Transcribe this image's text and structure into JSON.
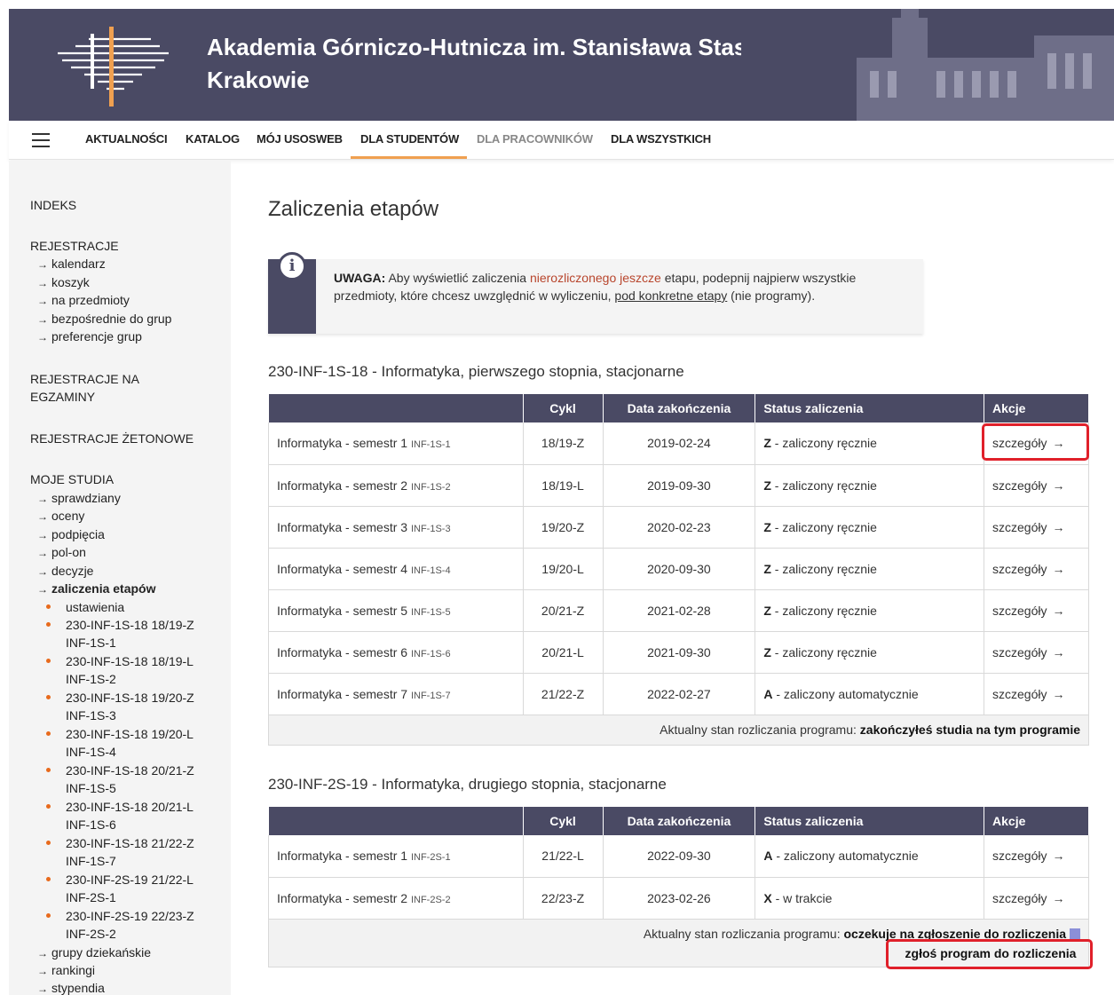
{
  "header": {
    "university_title": "Akademia Górniczo-Hutnicza im. Stanisława Staszica w Krakowie"
  },
  "topnav": {
    "items": [
      "AKTUALNOŚCI",
      "KATALOG",
      "MÓJ USOSWEB",
      "DLA STUDENTÓW",
      "DLA PRACOWNIKÓW",
      "DLA WSZYSTKICH"
    ],
    "active": "DLA STUDENTÓW"
  },
  "sidebar": {
    "indeks": "INDEKS",
    "rejestracje": "REJESTRACJE",
    "rejestracje_links": [
      "kalendarz",
      "koszyk",
      "na przedmioty",
      "bezpośrednie do grup",
      "preferencje grup"
    ],
    "rejestracje_egzaminy": "REJESTRACJE NA EGZAMINY",
    "rejestracje_zetonowe": "REJESTRACJE ŻETONOWE",
    "moje_studia": "MOJE STUDIA",
    "moje_studia_links": [
      "sprawdziany",
      "oceny",
      "podpięcia",
      "pol-on",
      "decyzje",
      "zaliczenia etapów"
    ],
    "zaliczenia_sub": [
      "ustawienia",
      "230-INF-1S-18 18/19-Z INF-1S-1",
      "230-INF-1S-18 18/19-L INF-1S-2",
      "230-INF-1S-18 19/20-Z INF-1S-3",
      "230-INF-1S-18 19/20-L INF-1S-4",
      "230-INF-1S-18 20/21-Z INF-1S-5",
      "230-INF-1S-18 20/21-L INF-1S-6",
      "230-INF-1S-18 21/22-Z INF-1S-7",
      "230-INF-2S-19 21/22-L INF-2S-1",
      "230-INF-2S-19 22/23-Z INF-2S-2"
    ],
    "bottom_links": [
      "grupy dziekańskie",
      "rankingi",
      "stypendia"
    ]
  },
  "main": {
    "page_title": "Zaliczenia etapów",
    "notice": {
      "lead": "UWAGA:",
      "part1": " Aby wyświetlić zaliczenia ",
      "red": "nierozliczonego jeszcze",
      "part2": " etapu, podepnij najpierw wszystkie przedmioty, które chcesz uwzględnić w wyliczeniu, ",
      "link": "pod konkretne etapy",
      "part3": " (nie programy)."
    },
    "columns": [
      "",
      "Cykl",
      "Data zakończenia",
      "Status zaliczenia",
      "Akcje"
    ],
    "action_label": "szczegóły",
    "footer_label": "Aktualny stan rozliczania programu: ",
    "programs": [
      {
        "title": "230-INF-1S-18 - Informatyka, pierwszego stopnia, stacjonarne",
        "rows": [
          {
            "name": "Informatyka - semestr 1",
            "code": "INF-1S-1",
            "cycle": "18/19-Z",
            "date": "2019-02-24",
            "status_code": "Z",
            "status_text": " - zaliczony ręcznie"
          },
          {
            "name": "Informatyka - semestr 2",
            "code": "INF-1S-2",
            "cycle": "18/19-L",
            "date": "2019-09-30",
            "status_code": "Z",
            "status_text": " - zaliczony ręcznie"
          },
          {
            "name": "Informatyka - semestr 3",
            "code": "INF-1S-3",
            "cycle": "19/20-Z",
            "date": "2020-02-23",
            "status_code": "Z",
            "status_text": " - zaliczony ręcznie"
          },
          {
            "name": "Informatyka - semestr 4",
            "code": "INF-1S-4",
            "cycle": "19/20-L",
            "date": "2020-09-30",
            "status_code": "Z",
            "status_text": " - zaliczony ręcznie"
          },
          {
            "name": "Informatyka - semestr 5",
            "code": "INF-1S-5",
            "cycle": "20/21-Z",
            "date": "2021-02-28",
            "status_code": "Z",
            "status_text": " - zaliczony ręcznie"
          },
          {
            "name": "Informatyka - semestr 6",
            "code": "INF-1S-6",
            "cycle": "20/21-L",
            "date": "2021-09-30",
            "status_code": "Z",
            "status_text": " - zaliczony ręcznie"
          },
          {
            "name": "Informatyka - semestr 7",
            "code": "INF-1S-7",
            "cycle": "21/22-Z",
            "date": "2022-02-27",
            "status_code": "A",
            "status_text": " - zaliczony automatycznie"
          }
        ],
        "footer_status": "zakończyłeś studia na tym programie"
      },
      {
        "title": "230-INF-2S-19 - Informatyka, drugiego stopnia, stacjonarne",
        "rows": [
          {
            "name": "Informatyka - semestr 1",
            "code": "INF-2S-1",
            "cycle": "21/22-L",
            "date": "2022-09-30",
            "status_code": "A",
            "status_text": " - zaliczony automatycznie"
          },
          {
            "name": "Informatyka - semestr 2",
            "code": "INF-2S-2",
            "cycle": "22/23-Z",
            "date": "2023-02-26",
            "status_code": "X",
            "status_text": " - w trakcie"
          }
        ],
        "footer_status": "oczekuje na zgłoszenie do rozliczenia",
        "footer_button": "zgłoś program do rozliczenia"
      }
    ]
  },
  "colors": {
    "header_bg": "#4a4a64",
    "accent_orange": "#f0a050",
    "highlight_red": "#e0202a",
    "notice_red_text": "#b8452c"
  }
}
